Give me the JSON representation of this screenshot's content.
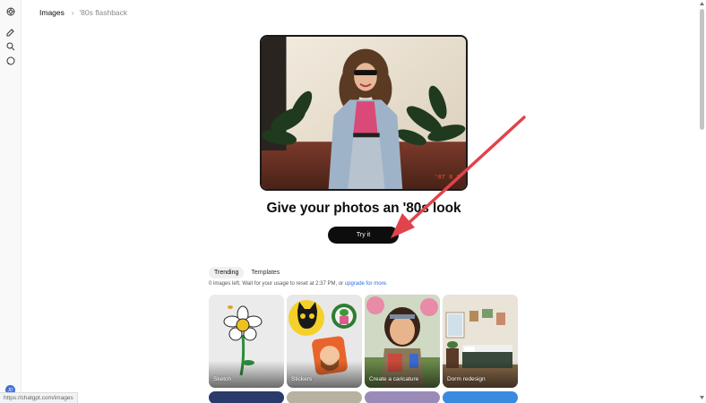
{
  "breadcrumb": {
    "root": "Images",
    "separator": "›",
    "current": "'80s flashback"
  },
  "hero": {
    "title": "Give your photos an '80s look",
    "button": "Try it"
  },
  "tabs": [
    {
      "label": "Trending",
      "active": true
    },
    {
      "label": "Templates",
      "active": false
    }
  ],
  "usage": {
    "text": "0 images left. Wait for your usage to reset at 2:37 PM, or ",
    "link": "upgrade for more."
  },
  "cards": [
    {
      "label": "Sketch"
    },
    {
      "label": "Stickers"
    },
    {
      "label": "Create a caricature"
    },
    {
      "label": "Dorm redesign"
    }
  ],
  "avatar": {
    "initials": "JD"
  },
  "status_url": "https://chatgpt.com/images",
  "icons": {
    "logo": "openai-logo-icon",
    "new_chat": "edit-icon",
    "search": "search-icon",
    "chat": "chat-bubble-icon"
  },
  "colors": {
    "accent": "#2f6ee7",
    "button": "#0d0d0d",
    "arrow": "#e0444a"
  }
}
